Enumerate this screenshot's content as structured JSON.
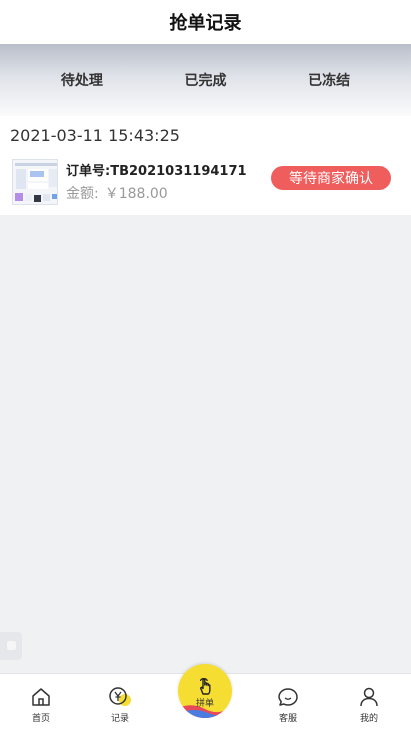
{
  "header": {
    "title": "抢单记录"
  },
  "tabs": [
    {
      "label": "待处理"
    },
    {
      "label": "已完成"
    },
    {
      "label": "已冻结"
    }
  ],
  "record": {
    "time": "2021-03-11 15:43:25",
    "order_no": "订单号:TB2021031194171",
    "amount_label": "金额:",
    "amount_value": "￥188.00",
    "status": "等待商家确认"
  },
  "tabbar": {
    "items": [
      {
        "label": "首页",
        "icon": "home-icon"
      },
      {
        "label": "记录",
        "icon": "record-yen-icon"
      },
      {
        "label": "拼单",
        "icon": "tap-hand-icon"
      },
      {
        "label": "客服",
        "icon": "chat-icon"
      },
      {
        "label": "我的",
        "icon": "user-icon"
      }
    ]
  },
  "colors": {
    "status_badge": "#ef5d5d",
    "center_button": "#f6dd32",
    "background": "#f0f1f3"
  }
}
